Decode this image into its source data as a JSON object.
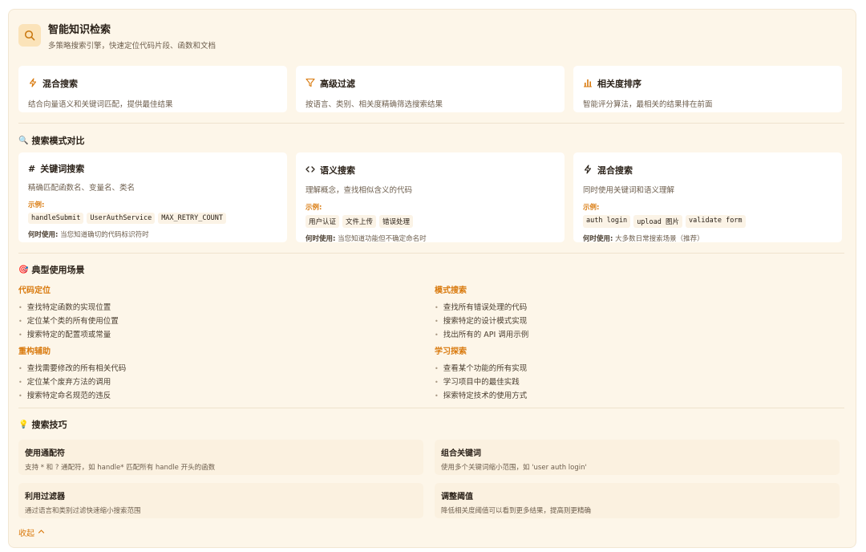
{
  "header": {
    "title": "智能知识检索",
    "subtitle": "多策略搜索引擎，快速定位代码片段、函数和文档",
    "icon": "search-icon"
  },
  "features": [
    {
      "icon": "lightning-icon",
      "title": "混合搜索",
      "desc": "结合向量语义和关键词匹配，提供最佳结果"
    },
    {
      "icon": "filter-icon",
      "title": "高级过滤",
      "desc": "按语言、类别、相关度精确筛选搜索结果"
    },
    {
      "icon": "bar-chart-icon",
      "title": "相关度排序",
      "desc": "智能评分算法，最相关的结果排在前面"
    }
  ],
  "modes": {
    "section_title": "搜索模式对比",
    "section_emoji": "🔍",
    "example_label": "示例:",
    "when_label": "何时使用:",
    "items": [
      {
        "icon": "hash-icon",
        "title": "关键词搜索",
        "desc": "精确匹配函数名、变量名、类名",
        "examples": [
          "handleSubmit",
          "UserAuthService",
          "MAX_RETRY_COUNT"
        ],
        "when": "当您知道确切的代码标识符时"
      },
      {
        "icon": "code-icon",
        "title": "语义搜索",
        "desc": "理解概念，查找相似含义的代码",
        "examples": [
          "用户认证",
          "文件上传",
          "错误处理"
        ],
        "when": "当您知道功能但不确定命名时"
      },
      {
        "icon": "lightning-icon",
        "title": "混合搜索",
        "desc": "同时使用关键词和语义理解",
        "examples": [
          "auth login",
          "upload 图片",
          "validate form"
        ],
        "when": "大多数日常搜索场景（推荐）"
      }
    ]
  },
  "scenarios": {
    "section_title": "典型使用场景",
    "section_emoji": "🎯",
    "groups": [
      {
        "title": "代码定位",
        "items": [
          "查找特定函数的实现位置",
          "定位某个类的所有使用位置",
          "搜索特定的配置项或常量"
        ]
      },
      {
        "title": "模式搜索",
        "items": [
          "查找所有错误处理的代码",
          "搜索特定的设计模式实现",
          "找出所有的 API 调用示例"
        ]
      },
      {
        "title": "重构辅助",
        "items": [
          "查找需要修改的所有相关代码",
          "定位某个废弃方法的调用",
          "搜索特定命名规范的违反"
        ]
      },
      {
        "title": "学习探索",
        "items": [
          "查看某个功能的所有实现",
          "学习项目中的最佳实践",
          "探索特定技术的使用方式"
        ]
      }
    ]
  },
  "tips": {
    "section_title": "搜索技巧",
    "section_emoji": "💡",
    "items": [
      {
        "title": "使用通配符",
        "desc": "支持 * 和 ? 通配符，如 handle* 匹配所有 handle 开头的函数"
      },
      {
        "title": "组合关键词",
        "desc": "使用多个关键词缩小范围，如 'user auth login'"
      },
      {
        "title": "利用过滤器",
        "desc": "通过语言和类别过滤快速缩小搜索范围"
      },
      {
        "title": "调整阈值",
        "desc": "降低相关度阈值可以看到更多结果，提高则更精确"
      }
    ]
  },
  "collapse_label": "收起",
  "colors": {
    "accent": "#d97a0e",
    "panel_bg": "#fdf6e9",
    "card_bg": "#ffffff"
  }
}
